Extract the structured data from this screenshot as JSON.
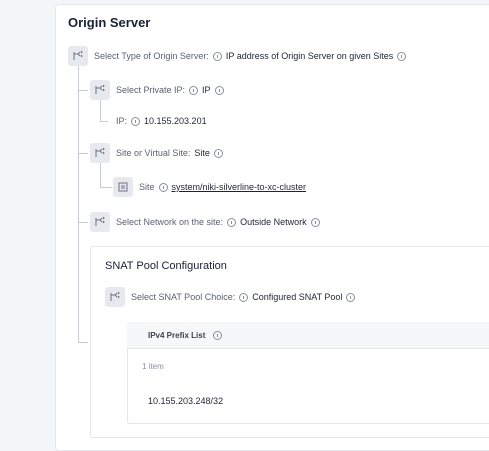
{
  "section": {
    "title": "Origin Server"
  },
  "origin_type": {
    "label": "Select Type of Origin Server:",
    "value": "IP address of Origin Server on given Sites"
  },
  "private_ip": {
    "label": "Select Private IP:",
    "value": "IP"
  },
  "ip": {
    "label": "IP:",
    "value": "10.155.203.201"
  },
  "site_choice": {
    "label": "Site or Virtual Site:",
    "value": "Site"
  },
  "site": {
    "label": "Site",
    "value": "system/niki-silverline-to-xc-cluster"
  },
  "network": {
    "label": "Select Network on the site:",
    "value": "Outside Network"
  },
  "snat": {
    "title": "SNAT Pool Configuration",
    "choice_label": "Select SNAT Pool Choice:",
    "choice_value": "Configured SNAT Pool",
    "prefix_list_header": "IPv4 Prefix List",
    "item_count": "1 item",
    "items": [
      "10.155.203.248/32"
    ]
  },
  "icons": {
    "choice": "choice-node-icon",
    "object": "object-ref-icon",
    "info": "info-icon"
  }
}
